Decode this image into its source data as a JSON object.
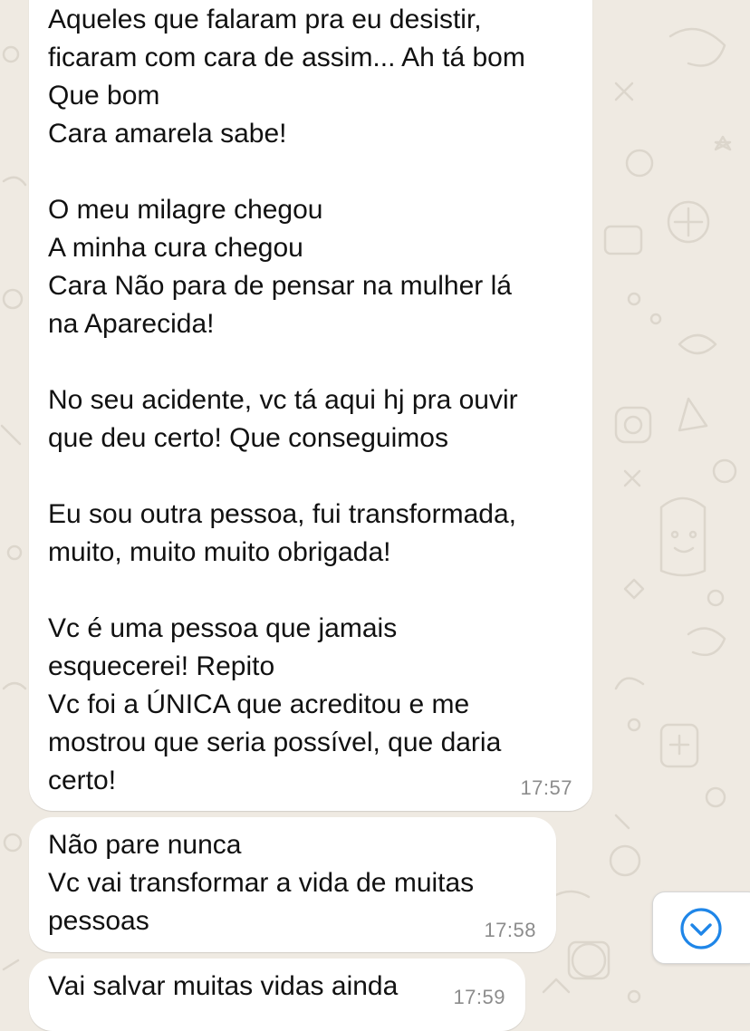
{
  "theme": {
    "chat_background": "#efeae2",
    "bubble_background": "#ffffff",
    "text_color": "#111111",
    "time_color": "#8c8c8c",
    "accent": "#1f86e8"
  },
  "messages": [
    {
      "text": "Aqueles que falaram pra eu desistir,\nficaram com cara de assim... Ah tá bom\nQue bom\nCara amarela sabe!\n\nO meu milagre chegou\nA minha cura chegou\nCara Não para de pensar na mulher lá\nna Aparecida!\n\nNo seu acidente, vc tá aqui hj pra ouvir\nque deu certo! Que conseguimos\n\nEu sou outra pessoa, fui transformada,\nmuito, muito muito obrigada!\n\nVc é uma pessoa que jamais\nesquecerei! Repito\nVc foi a ÚNICA que acreditou e me\nmostrou que seria possível, que daria\ncerto!",
      "time": "17:57"
    },
    {
      "text": "Não pare nunca\nVc vai transformar a vida de muitas\npessoas",
      "time": "17:58"
    },
    {
      "text": "Vai salvar muitas vidas ainda",
      "time": "17:59"
    }
  ],
  "scroll_button": {
    "icon": "chevron-down-circle-icon"
  }
}
